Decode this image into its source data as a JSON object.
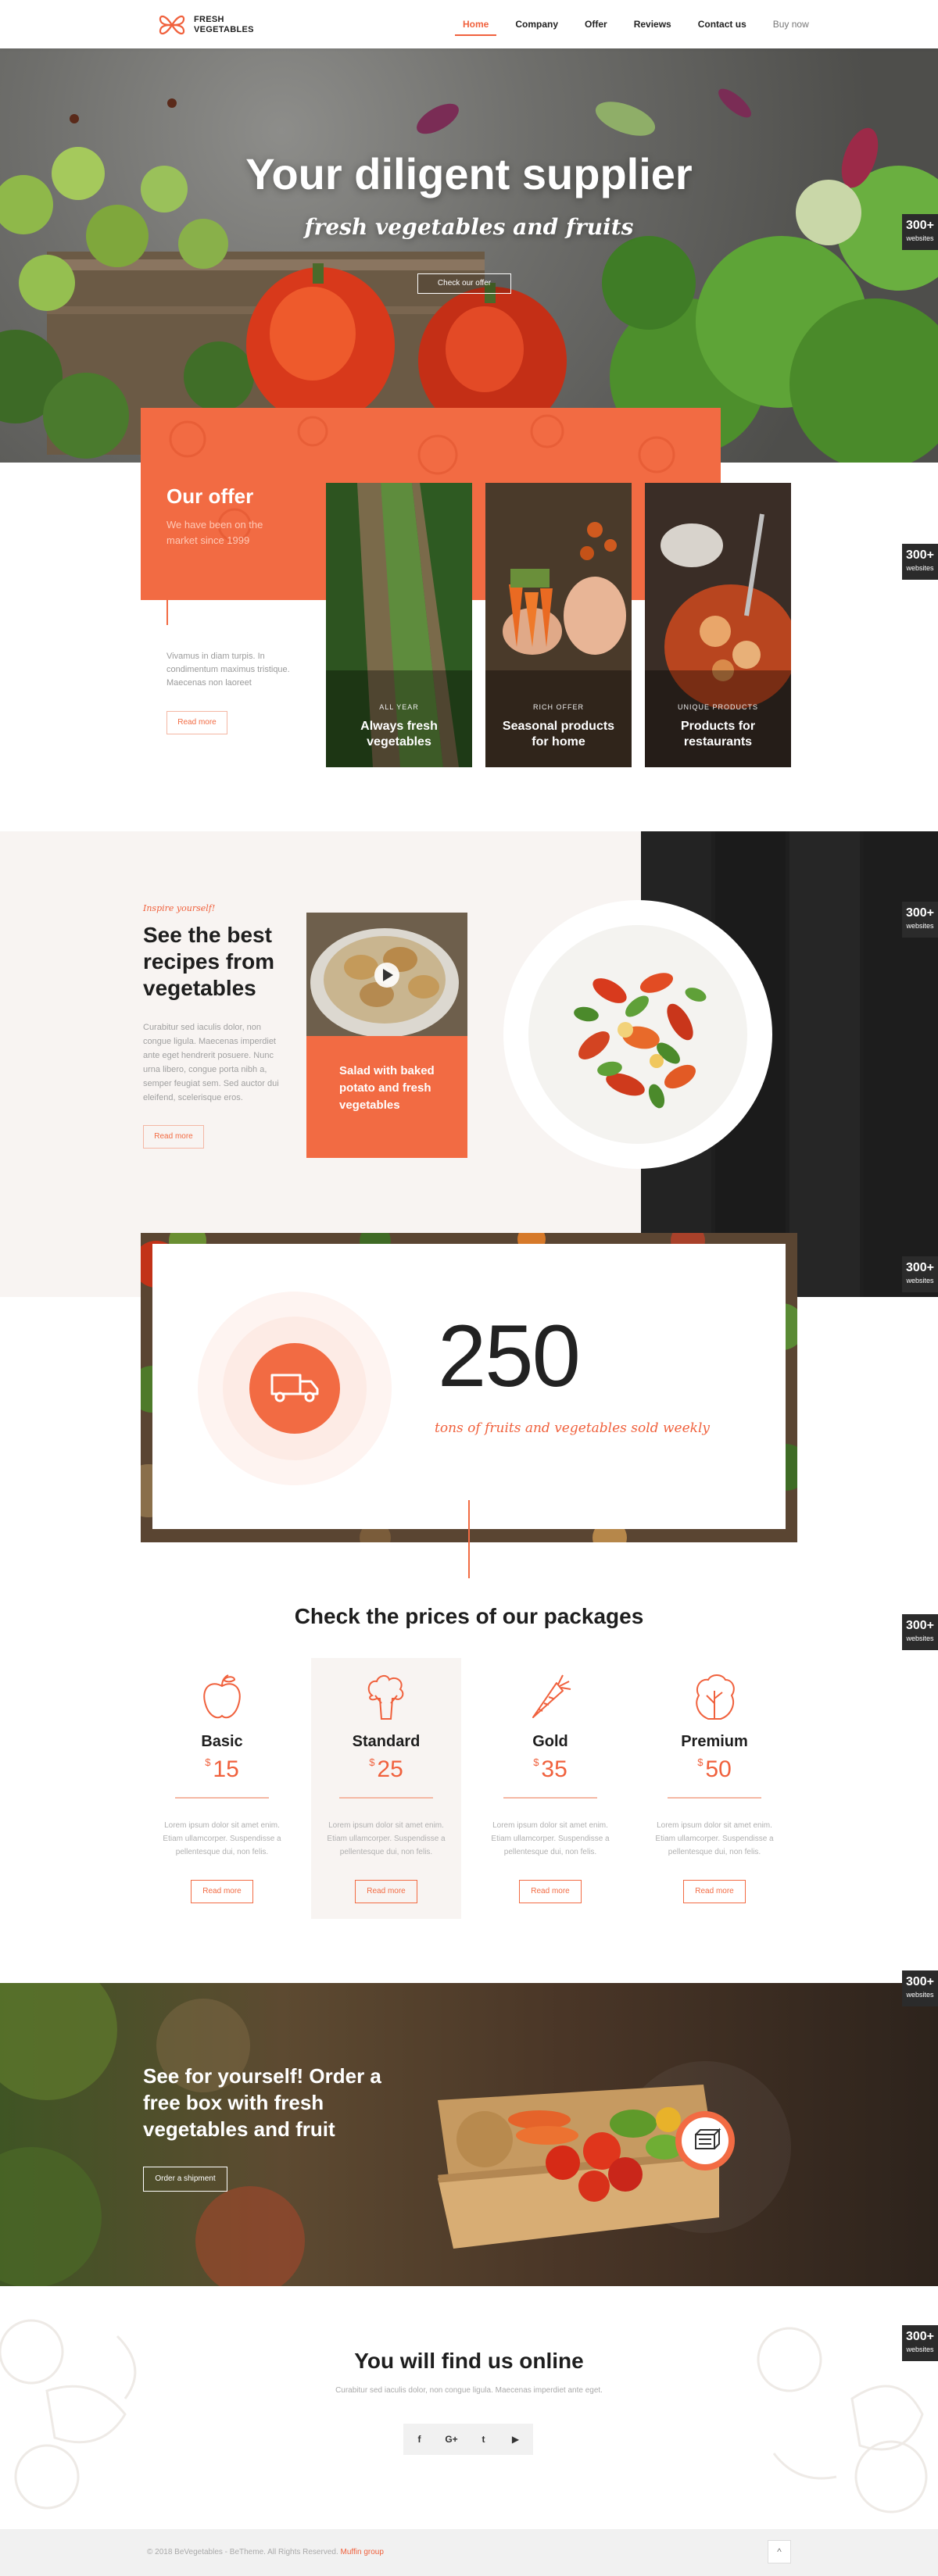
{
  "colors": {
    "accent": "#f0613d",
    "offer_bg": "#f26b43",
    "light_bg": "#f8f4f2",
    "dark": "#1e1e1e"
  },
  "header": {
    "logo_icon": "butterfly-leaf-icon",
    "logo_line1": "FRESH",
    "logo_line2": "VEGETABLES",
    "nav": [
      {
        "label": "Home",
        "active": true
      },
      {
        "label": "Company"
      },
      {
        "label": "Offer"
      },
      {
        "label": "Reviews"
      },
      {
        "label": "Contact us"
      },
      {
        "label": "Buy now"
      }
    ]
  },
  "hero": {
    "title": "Your diligent supplier",
    "subtitle": "fresh vegetables and fruits",
    "button": "Check our offer"
  },
  "side_badge": {
    "number": "300+",
    "label": "websites"
  },
  "offer": {
    "title": "Our offer",
    "lead": "We have been on the market since 1999",
    "description": "Vivamus in diam turpis. In condimentum maximus tristique. Maecenas non laoreet",
    "read_more": "Read more",
    "cards": [
      {
        "kicker": "ALL YEAR",
        "title": "Always fresh vegetables"
      },
      {
        "kicker": "RICH OFFER",
        "title": "Seasonal products for home"
      },
      {
        "kicker": "UNIQUE PRODUCTS",
        "title": "Products for restaurants"
      }
    ]
  },
  "recipes": {
    "kicker": "Inspire yourself!",
    "title": "See the best recipes from vegetables",
    "description": "Curabitur sed iaculis dolor, non congue ligula. Maecenas imperdiet ante eget hendrerit posuere. Nunc urna libero, congue porta nibh a, semper feugiat sem. Sed auctor dui eleifend, scelerisque eros.",
    "read_more": "Read more",
    "card_label": "Salad with baked potato and fresh vegetables",
    "play_icon": "play-icon"
  },
  "counter": {
    "value": "250",
    "label": "tons of fruits and vegetables sold weekly",
    "icon": "truck-icon"
  },
  "prices": {
    "title": "Check the prices of our packages",
    "currency": "$",
    "packages": [
      {
        "name": "Basic",
        "price": "15",
        "icon": "apple-icon",
        "featured": false,
        "desc": "Lorem ipsum dolor sit amet enim. Etiam ullamcorper. Suspendisse a pellentesque dui, non felis.",
        "button": "Read more"
      },
      {
        "name": "Standard",
        "price": "25",
        "icon": "broccoli-icon",
        "featured": true,
        "desc": "Lorem ipsum dolor sit amet enim. Etiam ullamcorper. Suspendisse a pellentesque dui, non felis.",
        "button": "Read more"
      },
      {
        "name": "Gold",
        "price": "35",
        "icon": "carrot-icon",
        "featured": false,
        "desc": "Lorem ipsum dolor sit amet enim. Etiam ullamcorper. Suspendisse a pellentesque dui, non felis.",
        "button": "Read more"
      },
      {
        "name": "Premium",
        "price": "50",
        "icon": "lettuce-icon",
        "featured": false,
        "desc": "Lorem ipsum dolor sit amet enim. Etiam ullamcorper. Suspendisse a pellentesque dui, non felis.",
        "button": "Read more"
      }
    ]
  },
  "order": {
    "title": "See for yourself! Order a free box with fresh vegetables and fruit",
    "button": "Order a shipment",
    "badge_icon": "box-icon"
  },
  "online": {
    "title": "You will find us online",
    "subtitle": "Curabitur sed iaculis dolor, non congue ligula. Maecenas imperdiet ante eget.",
    "social": [
      {
        "icon": "facebook-icon",
        "glyph": "f"
      },
      {
        "icon": "google-plus-icon",
        "glyph": "G+"
      },
      {
        "icon": "twitter-icon",
        "glyph": "t"
      },
      {
        "icon": "youtube-icon",
        "glyph": "▶"
      }
    ]
  },
  "footer": {
    "copyright": "© 2018 BeVegetables - BeTheme. All Rights Reserved.",
    "link": "Muffin group",
    "to_top_icon": "chevron-up-icon"
  }
}
